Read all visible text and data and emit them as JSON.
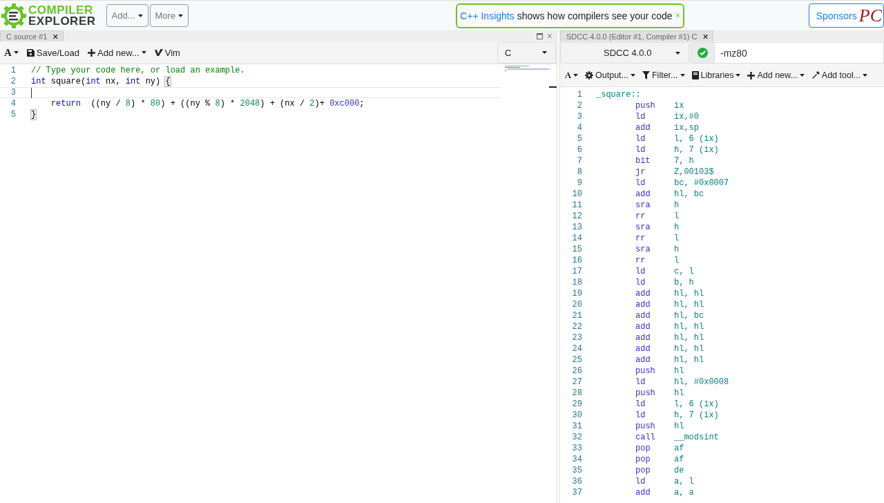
{
  "header": {
    "logo_top": "COMPILER",
    "logo_bottom": "EXPLORER",
    "menus": [
      "Add...",
      "More"
    ],
    "banner": {
      "link": "C++ Insights",
      "text": "shows how compilers see your code",
      "close": "×"
    },
    "sponsors": {
      "label": "Sponsors",
      "logo": "PC"
    }
  },
  "editor": {
    "tab": {
      "label": "C source #1",
      "close": "×"
    },
    "pane_close": "×",
    "toolbar": [
      {
        "kind": "font",
        "label": "A"
      },
      {
        "kind": "save",
        "label": "Save/Load"
      },
      {
        "kind": "add",
        "label": "Add new..."
      },
      {
        "kind": "vim",
        "label": "Vim"
      }
    ],
    "language": "C",
    "lines": [
      {
        "number": "1",
        "tokens": [
          {
            "text": "// Type your code here, or load an example.",
            "kind": "comment"
          }
        ],
        "current": false
      },
      {
        "number": "2",
        "tokens": [
          {
            "text": "int",
            "kind": "keyword"
          },
          {
            "text": " square(",
            "kind": "plain"
          },
          {
            "text": "int",
            "kind": "keyword"
          },
          {
            "text": " nx, ",
            "kind": "plain"
          },
          {
            "text": "int",
            "kind": "keyword"
          },
          {
            "text": " ny) ",
            "kind": "plain"
          },
          {
            "text": "{",
            "kind": "bracket"
          }
        ],
        "current": false
      },
      {
        "number": "3",
        "current": true
      },
      {
        "number": "4",
        "tokens": [
          {
            "text": "    return",
            "kind": "keyword"
          },
          {
            "text": "  ((ny / ",
            "kind": "plain"
          },
          {
            "text": "8",
            "kind": "number"
          },
          {
            "text": ") * ",
            "kind": "plain"
          },
          {
            "text": "80",
            "kind": "number"
          },
          {
            "text": ") + ((ny % ",
            "kind": "plain"
          },
          {
            "text": "8",
            "kind": "number"
          },
          {
            "text": ") * ",
            "kind": "plain"
          },
          {
            "text": "2048",
            "kind": "number"
          },
          {
            "text": ") + (nx / ",
            "kind": "plain"
          },
          {
            "text": "2",
            "kind": "number"
          },
          {
            "text": ")+ ",
            "kind": "plain"
          },
          {
            "text": "0xc000",
            "kind": "hex"
          },
          {
            "text": ";",
            "kind": "plain"
          }
        ],
        "current": false
      },
      {
        "number": "5",
        "tokens": [
          {
            "text": "}",
            "kind": "bracket"
          }
        ],
        "current": false
      }
    ]
  },
  "compiler": {
    "tab": {
      "label": "SDCC 4.0.0 (Editor #1, Compiler #1) C",
      "close": "×"
    },
    "name": "SDCC 4.0.0",
    "compiled_ok": true,
    "options": "-mz80",
    "toolbar": [
      {
        "kind": "font",
        "label": "A"
      },
      {
        "kind": "output",
        "label": "Output..."
      },
      {
        "kind": "filter",
        "label": "Filter..."
      },
      {
        "kind": "libraries",
        "label": "Libraries"
      },
      {
        "kind": "add",
        "label": "Add new..."
      },
      {
        "kind": "tool",
        "label": "Add tool..."
      }
    ],
    "asm": [
      {
        "number": "1",
        "label": "_square::"
      },
      {
        "number": "2",
        "op": "push",
        "args": "ix"
      },
      {
        "number": "3",
        "op": "ld",
        "args": "ix,#0"
      },
      {
        "number": "4",
        "op": "add",
        "args": "ix,sp"
      },
      {
        "number": "5",
        "op": "ld",
        "args": "l, 6 (ix)"
      },
      {
        "number": "6",
        "op": "ld",
        "args": "h, 7 (ix)"
      },
      {
        "number": "7",
        "op": "bit",
        "args": "7, h"
      },
      {
        "number": "8",
        "op": "jr",
        "args": "Z,00103$"
      },
      {
        "number": "9",
        "op": "ld",
        "args": "bc, #0x0007"
      },
      {
        "number": "10",
        "op": "add",
        "args": "hl, bc"
      },
      {
        "number": "11",
        "op": "sra",
        "args": "h"
      },
      {
        "number": "12",
        "op": "rr",
        "args": "l"
      },
      {
        "number": "13",
        "op": "sra",
        "args": "h"
      },
      {
        "number": "14",
        "op": "rr",
        "args": "l"
      },
      {
        "number": "15",
        "op": "sra",
        "args": "h"
      },
      {
        "number": "16",
        "op": "rr",
        "args": "l"
      },
      {
        "number": "17",
        "op": "ld",
        "args": "c, l"
      },
      {
        "number": "18",
        "op": "ld",
        "args": "b, h"
      },
      {
        "number": "19",
        "op": "add",
        "args": "hl, hl"
      },
      {
        "number": "20",
        "op": "add",
        "args": "hl, hl"
      },
      {
        "number": "21",
        "op": "add",
        "args": "hl, bc"
      },
      {
        "number": "22",
        "op": "add",
        "args": "hl, hl"
      },
      {
        "number": "23",
        "op": "add",
        "args": "hl, hl"
      },
      {
        "number": "24",
        "op": "add",
        "args": "hl, hl"
      },
      {
        "number": "25",
        "op": "add",
        "args": "hl, hl"
      },
      {
        "number": "26",
        "op": "push",
        "args": "hl"
      },
      {
        "number": "27",
        "op": "ld",
        "args": "hl, #0x0008"
      },
      {
        "number": "28",
        "op": "push",
        "args": "hl"
      },
      {
        "number": "29",
        "op": "ld",
        "args": "l, 6 (ix)"
      },
      {
        "number": "30",
        "op": "ld",
        "args": "h, 7 (ix)"
      },
      {
        "number": "31",
        "op": "push",
        "args": "hl"
      },
      {
        "number": "32",
        "op": "call",
        "args": "__modsint"
      },
      {
        "number": "33",
        "op": "pop",
        "args": "af"
      },
      {
        "number": "34",
        "op": "pop",
        "args": "af"
      },
      {
        "number": "35",
        "op": "pop",
        "args": "de"
      },
      {
        "number": "36",
        "op": "ld",
        "args": "a, l"
      },
      {
        "number": "37",
        "op": "add",
        "args": "a, a"
      }
    ]
  }
}
